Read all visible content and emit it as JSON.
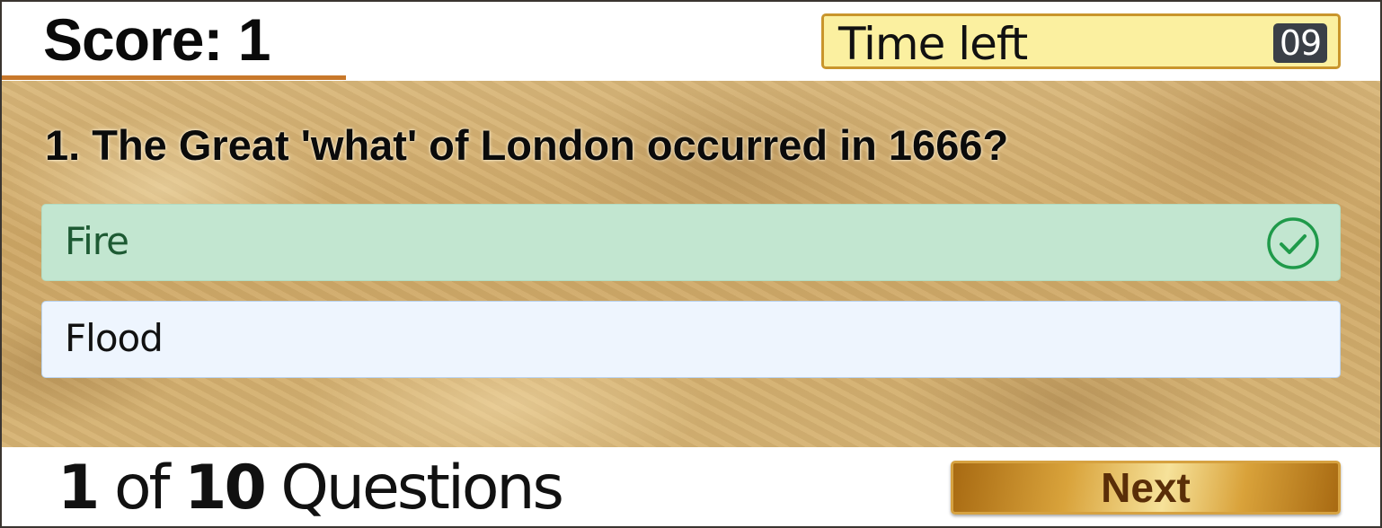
{
  "header": {
    "score_label": "Score: 1",
    "timer_label": "Time left",
    "timer_value": "09"
  },
  "question": {
    "text": "1. The Great 'what' of London occurred in 1666?"
  },
  "answers": [
    {
      "label": "Fire",
      "state": "correct",
      "icon": "check-circle-icon"
    },
    {
      "label": "Flood",
      "state": "default"
    }
  ],
  "footer": {
    "current": "1",
    "of_word": "of",
    "total": "10",
    "questions_word": "Questions",
    "next_label": "Next"
  },
  "colors": {
    "correct_bg": "#c2e6d0",
    "correct_text": "#1d5a33",
    "correct_icon": "#1f9a4a",
    "default_bg": "#eef5fe",
    "timer_bg": "#fbf0a0",
    "accent": "#c8782a"
  }
}
